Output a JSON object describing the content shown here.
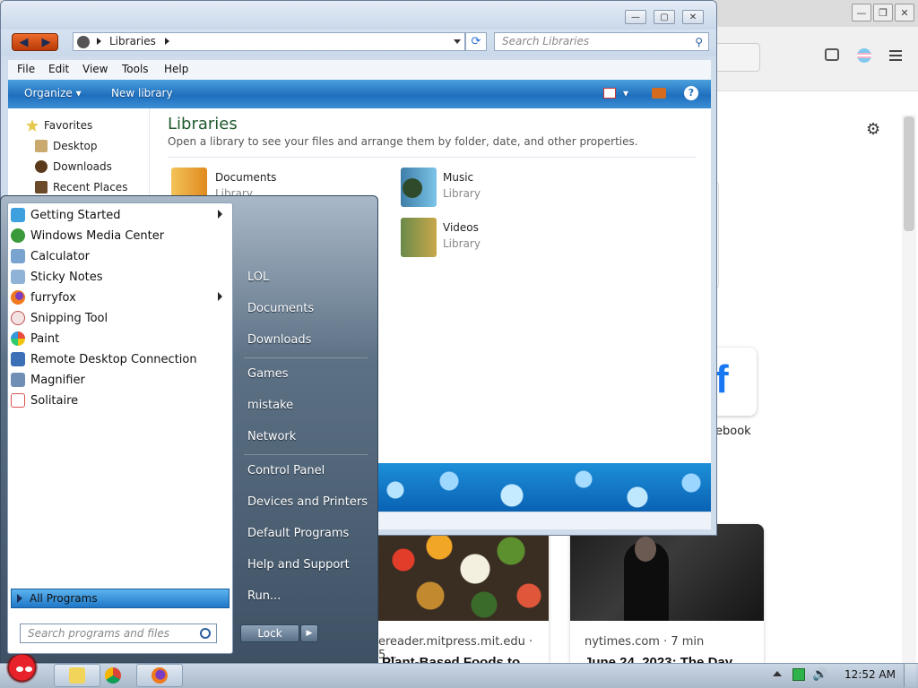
{
  "browser": {
    "facebook_label": "ebook",
    "news": [
      {
        "source": "ereader.mitpress.mit.edu · 5...",
        "headline": "Plant-Based Foods to"
      },
      {
        "source": "nytimes.com · 7 min",
        "headline": "June 24, 2023: The Day"
      }
    ]
  },
  "explorer": {
    "address": "Libraries",
    "search_placeholder": "Search Libraries",
    "menu": [
      "File",
      "Edit",
      "View",
      "Tools",
      "Help"
    ],
    "commands": {
      "organize": "Organize",
      "new_library": "New library"
    },
    "nav": {
      "favorites": "Favorites",
      "items": [
        "Desktop",
        "Downloads",
        "Recent Places"
      ]
    },
    "title": "Libraries",
    "subtitle": "Open a library to see your files and arrange them by folder, date, and other properties.",
    "libraries": [
      {
        "name": "Documents",
        "type": "Library"
      },
      {
        "name": "Music",
        "type": "Library"
      },
      {
        "name": "Videos",
        "type": "Library"
      }
    ]
  },
  "startmenu": {
    "programs": [
      {
        "label": "Getting Started",
        "submenu": true,
        "icon": "getting-started-icon",
        "color": "#3fa0e0"
      },
      {
        "label": "Windows Media Center",
        "submenu": false,
        "icon": "media-center-icon",
        "color": "#3a9a3a"
      },
      {
        "label": "Calculator",
        "submenu": false,
        "icon": "calculator-icon",
        "color": "#7aa4d0"
      },
      {
        "label": "Sticky Notes",
        "submenu": false,
        "icon": "sticky-notes-icon",
        "color": "#8fb3d6"
      },
      {
        "label": "furryfox",
        "submenu": true,
        "icon": "firefox-icon",
        "color": "#f07a1e"
      },
      {
        "label": "Snipping Tool",
        "submenu": false,
        "icon": "scissors-icon",
        "color": "#c0504d"
      },
      {
        "label": "Paint",
        "submenu": false,
        "icon": "paint-icon",
        "color": "#5b9bd5"
      },
      {
        "label": "Remote Desktop Connection",
        "submenu": false,
        "icon": "remote-desktop-icon",
        "color": "#3b6fb6"
      },
      {
        "label": "Magnifier",
        "submenu": false,
        "icon": "magnifier-icon",
        "color": "#6f8fb5"
      },
      {
        "label": "Solitaire",
        "submenu": false,
        "icon": "cards-icon",
        "color": "#d9534f"
      }
    ],
    "all_programs": "All Programs",
    "search_placeholder": "Search programs and files",
    "places": [
      "LOL",
      "Documents",
      "Downloads",
      "Games",
      "mistake",
      "Network",
      "Control Panel",
      "Devices and Printers",
      "Default Programs",
      "Help and Support",
      "Run..."
    ],
    "lock": "Lock"
  },
  "taskbar": {
    "clock": "12:52 AM",
    "pinned": [
      "explorer-icon",
      "chrome-icon",
      "firefox-icon"
    ]
  }
}
